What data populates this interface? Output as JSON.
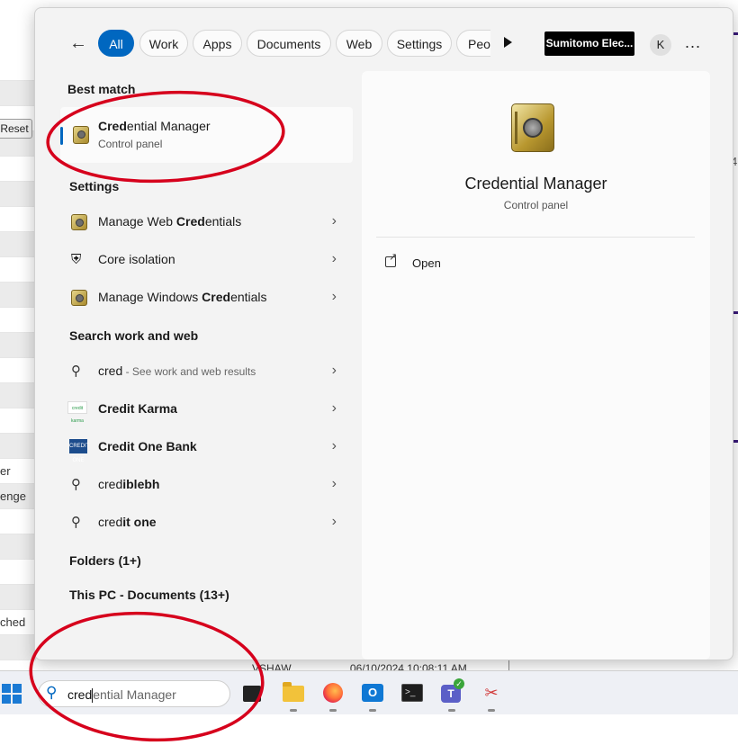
{
  "background_app": {
    "reset_label": "Reset",
    "right_edge_text": "4",
    "rows": [
      "",
      "",
      "",
      "",
      "",
      "",
      "",
      "",
      "",
      "",
      "",
      "",
      "",
      "",
      "",
      "",
      "er",
      "enge",
      "",
      "",
      "",
      "",
      "ched",
      ""
    ],
    "bottom_user": "VSHAW",
    "bottom_date": "06/10/2024 10:08:11 AM"
  },
  "filters": {
    "tabs": [
      "All",
      "Work",
      "Apps",
      "Documents",
      "Web",
      "Settings",
      "Peo"
    ],
    "active": "All",
    "org_badge": "Sumitomo Elec...",
    "avatar_initial": "K",
    "more_label": "..."
  },
  "best_match": {
    "section": "Best match",
    "title_bold": "Cred",
    "title_rest": "ential Manager",
    "subtitle": "Control panel",
    "icon": "credential-safe-icon"
  },
  "settings": {
    "section": "Settings",
    "items": [
      {
        "pre": "Manage Web ",
        "bold": "Cred",
        "post": "entials",
        "icon": "credential-safe-icon"
      },
      {
        "pre": "Core isolation",
        "bold": "",
        "post": "",
        "icon": "shield-icon"
      },
      {
        "pre": "Manage Windows ",
        "bold": "Cred",
        "post": "entials",
        "icon": "credential-safe-icon"
      }
    ]
  },
  "web": {
    "section": "Search work and web",
    "items": [
      {
        "bold": "",
        "pre": "cred",
        "post": "",
        "sub": " - See work and web results",
        "icon": "search-icon"
      },
      {
        "bold": "Cred",
        "pre": "",
        "post": "it Karma",
        "sub": "",
        "icon": "credit-karma-logo"
      },
      {
        "bold": "Cred",
        "pre": "",
        "post": "it One Bank",
        "sub": "",
        "icon": "credit-one-logo"
      },
      {
        "bold": "cred",
        "pre": "",
        "post": "iblebh",
        "sub": "",
        "icon": "search-icon"
      },
      {
        "bold": "cred",
        "pre": "",
        "post": "it one",
        "sub": "",
        "icon": "search-icon"
      }
    ]
  },
  "folders": {
    "label": "Folders (1+)"
  },
  "thispc": {
    "label": "This PC - Documents (13+)"
  },
  "preview": {
    "title": "Credential Manager",
    "subtitle": "Control panel",
    "action": "Open"
  },
  "taskbar": {
    "search_typed": "cred",
    "search_suggest": "ential Manager",
    "apps": [
      "blank-app-icon",
      "file-explorer-icon",
      "firefox-icon",
      "outlook-icon",
      "terminal-icon",
      "teams-icon",
      "snipping-tool-icon"
    ],
    "outlook_letter": "O",
    "teams_letter": "T",
    "terminal_prompt": ">_"
  },
  "colors": {
    "accent": "#0067c0",
    "annotation": "#d6001c"
  }
}
